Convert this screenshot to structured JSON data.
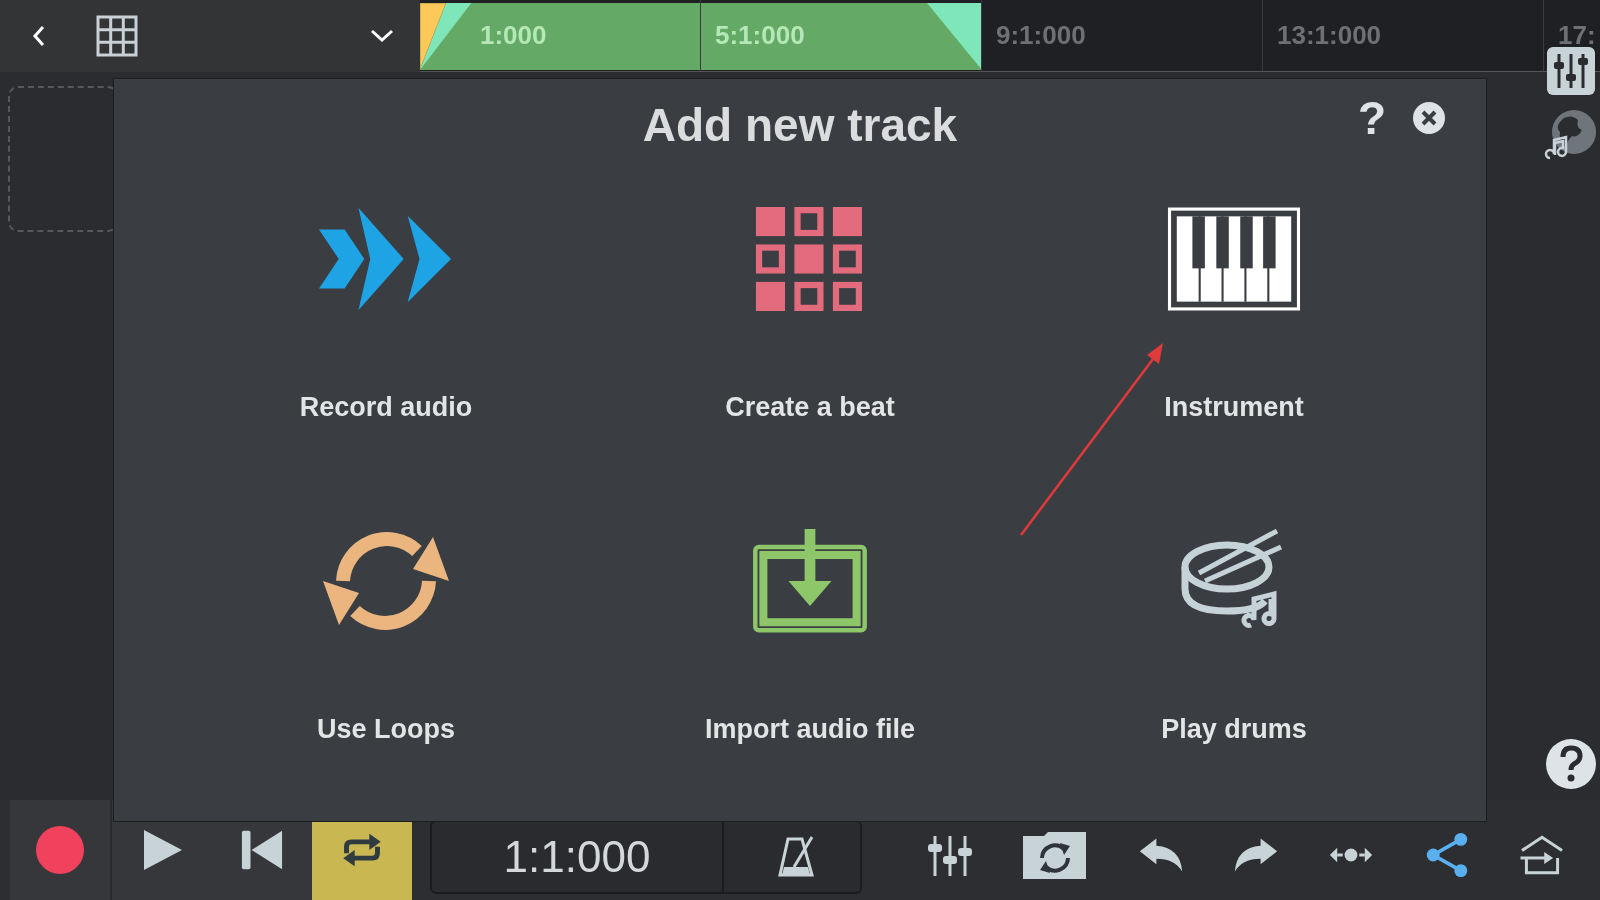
{
  "top_bar": {
    "timeline": [
      {
        "label": "1:000",
        "in_clip": true
      },
      {
        "label": "5:1:000",
        "in_clip": true
      },
      {
        "label": "9:1:000",
        "in_clip": false
      },
      {
        "label": "13:1:000",
        "in_clip": false
      },
      {
        "label": "17:",
        "in_clip": false
      }
    ]
  },
  "dialog": {
    "title": "Add new track",
    "help": "?",
    "tiles": [
      {
        "kind": "record",
        "label": "Record audio"
      },
      {
        "kind": "beat",
        "label": "Create a beat"
      },
      {
        "kind": "instrument",
        "label": "Instrument"
      },
      {
        "kind": "loops",
        "label": "Use Loops"
      },
      {
        "kind": "import",
        "label": "Import audio file"
      },
      {
        "kind": "drums",
        "label": "Play drums"
      }
    ]
  },
  "transport": {
    "loop_on": true,
    "time": "1:1:000"
  }
}
